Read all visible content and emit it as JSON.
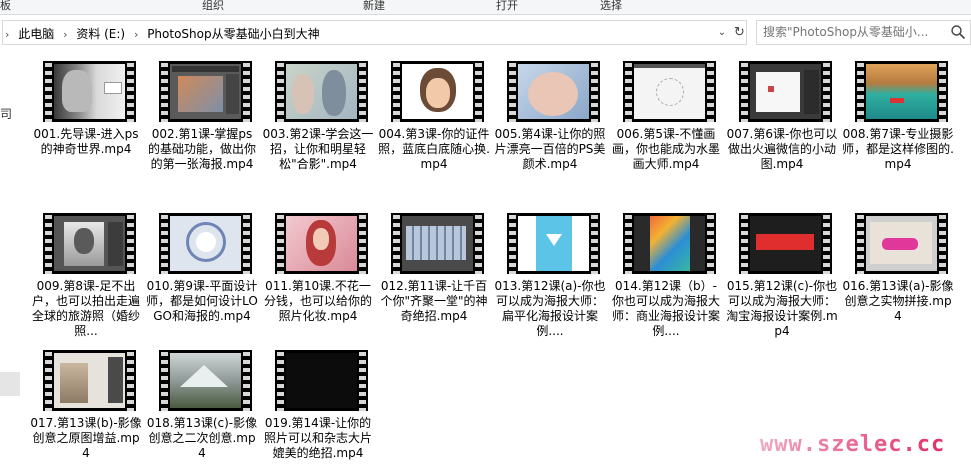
{
  "ribbon": {
    "labels": [
      "板",
      "组织",
      "新建",
      "打开",
      "选择"
    ]
  },
  "address": {
    "crumbs": [
      "此电脑",
      "资料 (E:)",
      "PhotoShop从零基础小白到大神"
    ],
    "separator": "›",
    "dropdown_icon": "chevron-down",
    "refresh_icon": "refresh"
  },
  "search": {
    "placeholder": "搜索\"PhotoShop从零基础小...",
    "icon": "search-icon"
  },
  "nav_pane": {
    "fragment": "司"
  },
  "files": [
    {
      "name": "001.先导课-进入ps的神奇世界.mp4"
    },
    {
      "name": "002.第1课-掌握ps的基础功能，做出你的第一张海报.mp4"
    },
    {
      "name": "003.第2课-学会这一招，让你和明星轻松\"合影\".mp4"
    },
    {
      "name": "004.第3课-你的证件照，蓝底白底随心换.mp4"
    },
    {
      "name": "005.第4课-让你的照片漂亮一百倍的PS美颜术.mp4"
    },
    {
      "name": "006.第5课-不懂画画，你也能成为水墨画大师.mp4"
    },
    {
      "name": "007.第6课-你也可以做出火遍微信的小动图.mp4"
    },
    {
      "name": "008.第7课-专业摄影师，都是这样修图的.mp4"
    },
    {
      "name": "009.第8课-足不出户，也可以拍出走遍全球的旅游照（婚纱照..."
    },
    {
      "name": "010.第9课-平面设计师，都是如何设计LOGO和海报的.mp4"
    },
    {
      "name": "011.第10课.不花一分钱，也可以给你的照片化妆.mp4"
    },
    {
      "name": "012.第11课-让千百个你\"齐聚一堂\"的神奇绝招.mp4"
    },
    {
      "name": "013.第12课(a)-你也可以成为海报大师：扁平化海报设计案例...."
    },
    {
      "name": "014.第12课（b）-你也可以成为海报大师：商业海报设计案例...."
    },
    {
      "name": "015.第12课(c)-你也可以成为海报大师：淘宝海报设计案例.mp4"
    },
    {
      "name": "016.第13课(a)-影像创意之实物拼接.mp4"
    },
    {
      "name": "017.第13课(b)-影像创意之原图增益.mp4"
    },
    {
      "name": "018.第13课(c)-影像创意之二次创意.mp4"
    },
    {
      "name": "019.第14课-让你的照片可以和杂志大片媲美的绝招.mp4"
    }
  ],
  "watermark": "www.szelec.cc",
  "colors": {
    "watermark_start": "#f2a8c2",
    "watermark_end": "#e0245e",
    "nav_selected": "#e5e5e5"
  }
}
